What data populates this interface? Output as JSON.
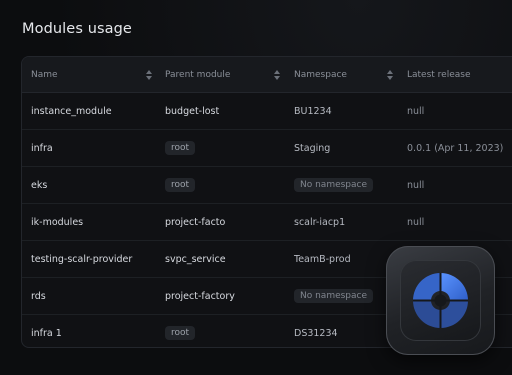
{
  "title": "Modules usage",
  "columns": [
    "Name",
    "Parent module",
    "Namespace",
    "Latest release"
  ],
  "rows": [
    {
      "name": "instance_module",
      "parent": "budget-lost",
      "parent_chip": false,
      "namespace": "BU1234",
      "namespace_chip": false,
      "release": "null"
    },
    {
      "name": "infra",
      "parent": "root",
      "parent_chip": true,
      "namespace": "Staging",
      "namespace_chip": false,
      "release": "0.0.1 (Apr 11, 2023)"
    },
    {
      "name": "eks",
      "parent": "root",
      "parent_chip": true,
      "namespace": "No namespace",
      "namespace_chip": true,
      "release": "null"
    },
    {
      "name": "ik-modules",
      "parent": "project-facto",
      "parent_chip": false,
      "namespace": "scalr-iacp1",
      "namespace_chip": false,
      "release": "null"
    },
    {
      "name": "testing-scalr-provider",
      "parent": "svpc_service",
      "parent_chip": false,
      "namespace": "TeamB-prod",
      "namespace_chip": false,
      "release": ""
    },
    {
      "name": "rds",
      "parent": "project-factory",
      "parent_chip": false,
      "namespace": "No namespace",
      "namespace_chip": true,
      "release": ""
    },
    {
      "name": "infra 1",
      "parent": "root",
      "parent_chip": true,
      "namespace": "DS31234",
      "namespace_chip": false,
      "release": ""
    }
  ],
  "app_icon": "scalr-logo-icon",
  "colors": {
    "accent": "#3b7cf0",
    "background": "#0c0d0f"
  }
}
